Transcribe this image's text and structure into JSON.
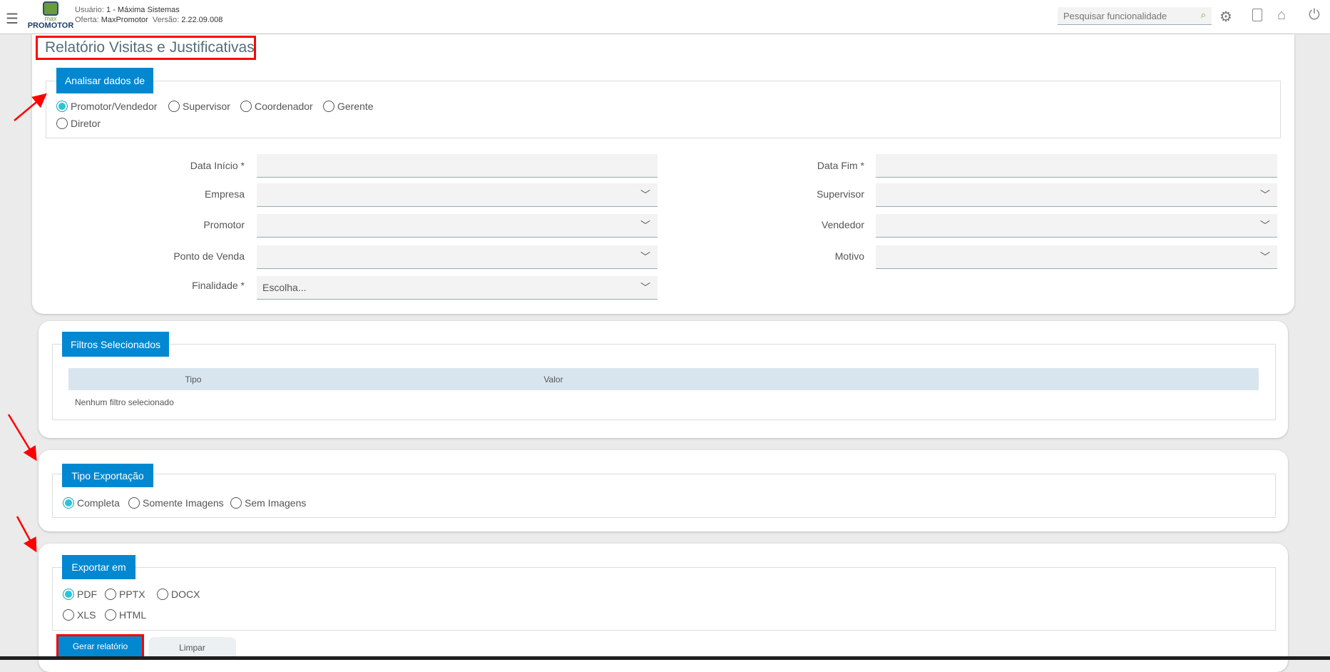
{
  "header": {
    "user_label": "Usuário:",
    "user": "1 - Máxima Sistemas",
    "offer_label": "Oferta:",
    "offer": "MaxPromotor",
    "version_label": "Versão:",
    "version": "2.22.09.008",
    "logo_top": "max",
    "logo_bottom": "PROMOTOR",
    "search_placeholder": "Pesquisar funcionalidade"
  },
  "page_title": "Relatório Visitas e Justificativas",
  "analisar": {
    "legend": "Analisar dados de",
    "options": [
      "Promotor/Vendedor",
      "Supervisor",
      "Coordenador",
      "Gerente",
      "Diretor"
    ],
    "selected": "Promotor/Vendedor"
  },
  "form": {
    "data_inicio": "Data Início *",
    "data_fim": "Data Fim *",
    "empresa": "Empresa",
    "supervisor": "Supervisor",
    "promotor": "Promotor",
    "vendedor": "Vendedor",
    "ponto_venda": "Ponto de Venda",
    "motivo": "Motivo",
    "finalidade": "Finalidade *",
    "finalidade_value": "Escolha..."
  },
  "filtros": {
    "legend": "Filtros Selecionados",
    "columns": [
      "Tipo",
      "Valor"
    ],
    "empty": "Nenhum filtro selecionado"
  },
  "tipo_exportacao": {
    "legend": "Tipo Exportação",
    "options": [
      "Completa",
      "Somente Imagens",
      "Sem Imagens"
    ],
    "selected": "Completa"
  },
  "exportar": {
    "legend": "Exportar em",
    "options": [
      "PDF",
      "PPTX",
      "DOCX",
      "XLS",
      "HTML"
    ],
    "selected": "PDF"
  },
  "buttons": {
    "gerar": "Gerar relatório",
    "limpar": "Limpar"
  },
  "colors": {
    "accent": "#0288d1",
    "radio": "#26c6da",
    "highlight": "#ff0000"
  }
}
